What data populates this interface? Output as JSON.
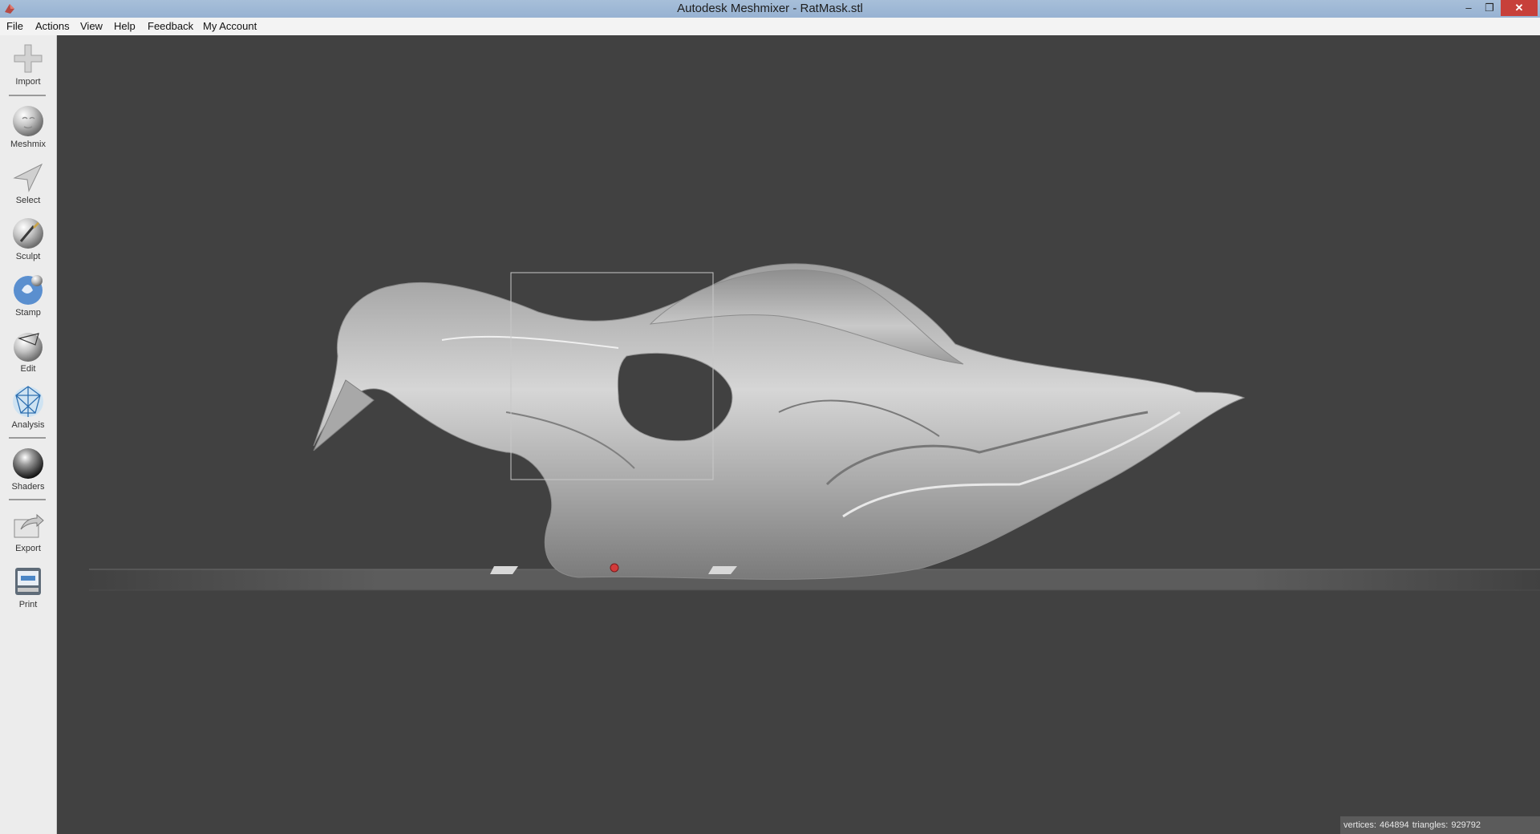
{
  "window": {
    "title": "Autodesk Meshmixer - RatMask.stl",
    "minimize_glyph": "–",
    "maximize_glyph": "❐",
    "close_glyph": "✕"
  },
  "menu": [
    "File",
    "Actions",
    "View",
    "Help",
    "Feedback",
    "My Account"
  ],
  "tools": [
    {
      "label": "Import",
      "icon": "plus-icon"
    },
    {
      "label": "Meshmix",
      "icon": "meshmix-face-icon"
    },
    {
      "label": "Select",
      "icon": "arrow-select-icon"
    },
    {
      "label": "Sculpt",
      "icon": "brush-icon"
    },
    {
      "label": "Stamp",
      "icon": "stamp-icon"
    },
    {
      "label": "Edit",
      "icon": "edit-sphere-icon"
    },
    {
      "label": "Analysis",
      "icon": "analysis-sphere-icon"
    },
    {
      "label": "Shaders",
      "icon": "shader-sphere-icon"
    },
    {
      "label": "Export",
      "icon": "export-icon"
    },
    {
      "label": "Print",
      "icon": "printer-icon"
    }
  ],
  "status": {
    "vertices_label": "vertices:",
    "vertices": "464894",
    "triangles_label": "triangles:",
    "triangles": "929792"
  },
  "colors": {
    "viewport_bg": "#414141",
    "mesh": "#b8b8b8",
    "ground": "#5a5a5a",
    "close_button": "#c7403a"
  }
}
